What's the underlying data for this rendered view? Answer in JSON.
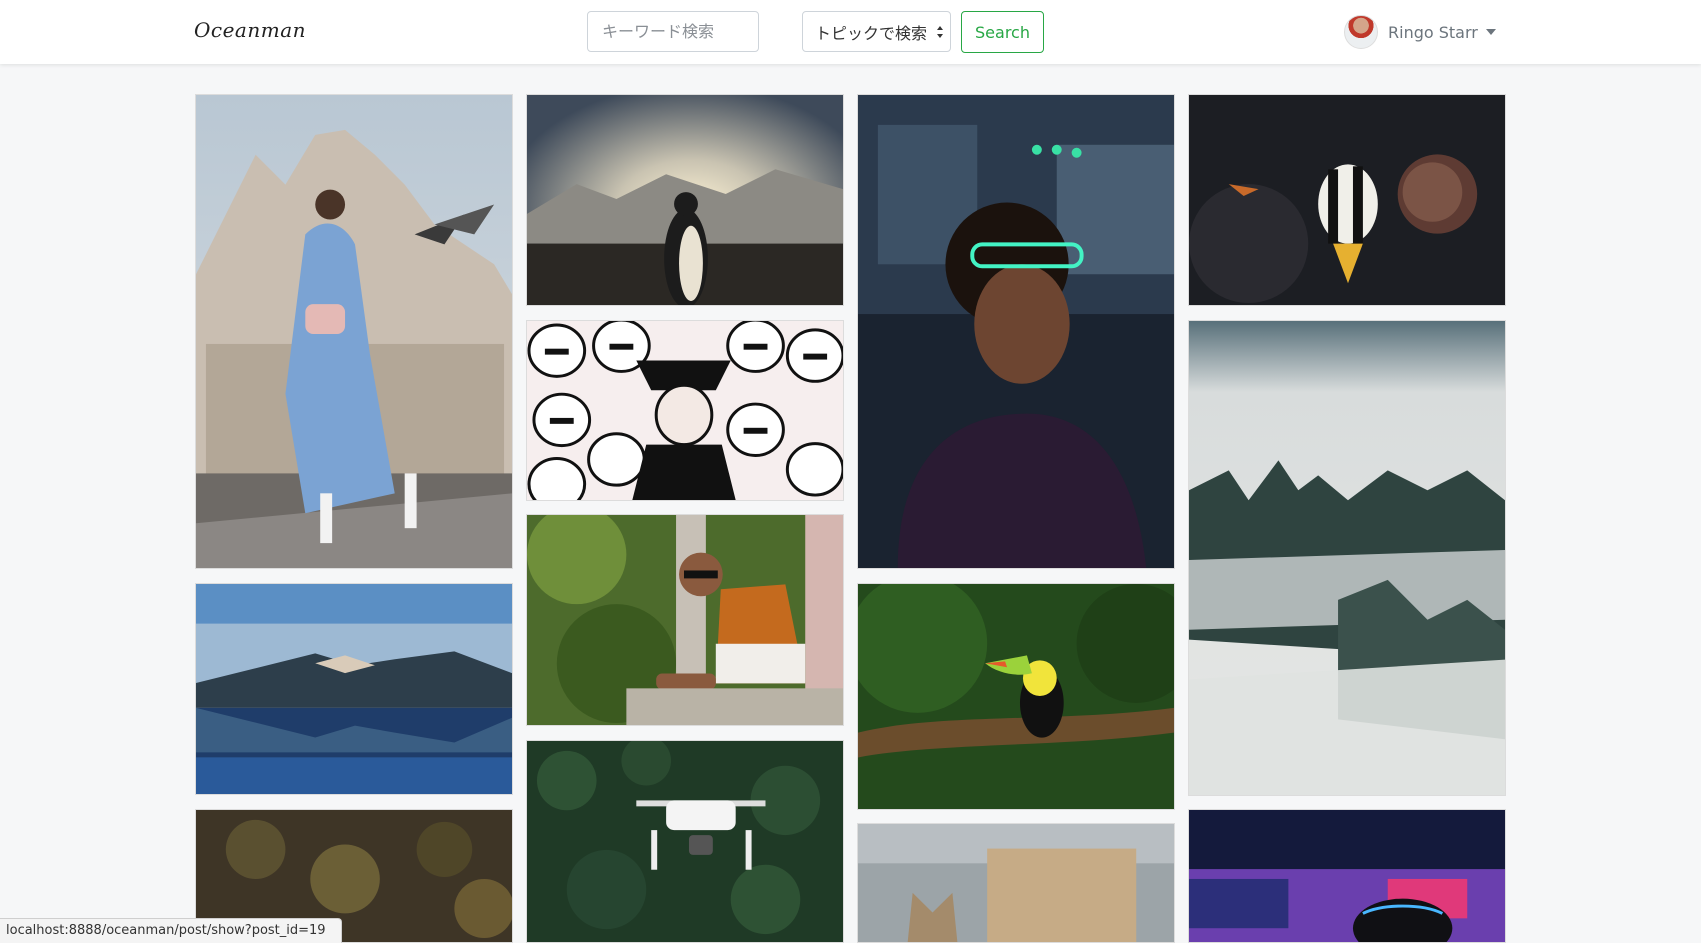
{
  "brand": "Oceanman",
  "search": {
    "keyword_placeholder": "キーワード検索",
    "topic_selected": "トピックで検索",
    "button_label": "Search"
  },
  "user": {
    "name": "Ringo Starr"
  },
  "gallery": [
    {
      "subject": "woman with pigeons at cathedral",
      "link": "post"
    },
    {
      "subject": "penguin at sunset mountains",
      "link": "post"
    },
    {
      "subject": "man with neon glasses",
      "link": "post"
    },
    {
      "subject": "striped fish on reef",
      "link": "post"
    },
    {
      "subject": "stormtrooper illustration",
      "link": "post"
    },
    {
      "subject": "misty forest",
      "link": "post"
    },
    {
      "subject": "man with sunglasses on balcony",
      "link": "post"
    },
    {
      "subject": "mountain lake reflection",
      "link": "post"
    },
    {
      "subject": "toucan on branch",
      "link": "post"
    },
    {
      "subject": "drone over forest",
      "link": "post"
    },
    {
      "subject": "leaves on dark background",
      "link": "post"
    },
    {
      "subject": "kitten",
      "link": "post"
    },
    {
      "subject": "vr headset neon lights",
      "link": "post"
    }
  ],
  "status_url": "localhost:8888/oceanman/post/show?post_id=19"
}
